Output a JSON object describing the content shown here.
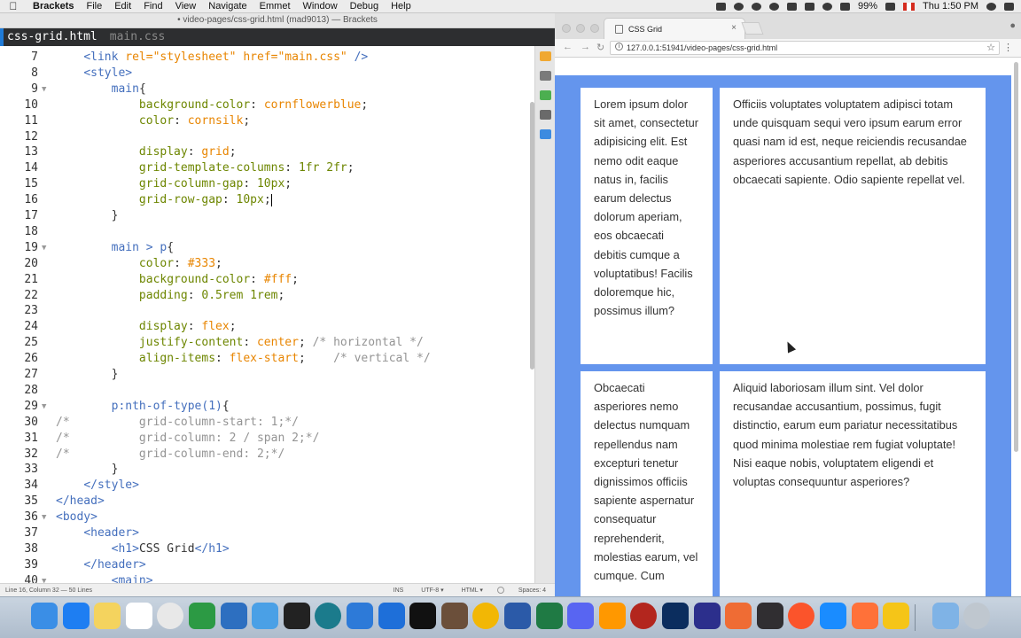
{
  "menubar": {
    "app": "Brackets",
    "items": [
      "File",
      "Edit",
      "Find",
      "View",
      "Navigate",
      "Emmet",
      "Window",
      "Debug",
      "Help"
    ],
    "battery": "99%",
    "clock": "Thu 1:50 PM"
  },
  "editor": {
    "window_title": "• video-pages/css-grid.html (mad9013) — Brackets",
    "tabs": [
      "css-grid.html",
      "main.css"
    ],
    "lines": [
      {
        "n": "7",
        "fold": "",
        "code": [
          [
            "    ",
            "pun"
          ],
          [
            "<link ",
            "tag"
          ],
          [
            "rel=",
            "attr"
          ],
          [
            "\"stylesheet\"",
            "str"
          ],
          [
            " href=",
            "attr"
          ],
          [
            "\"main.css\"",
            "str"
          ],
          [
            " />",
            "tag"
          ]
        ]
      },
      {
        "n": "8",
        "fold": "",
        "code": [
          [
            "    ",
            "pun"
          ],
          [
            "<style>",
            "tag"
          ]
        ]
      },
      {
        "n": "9",
        "fold": "▼",
        "code": [
          [
            "        ",
            "pun"
          ],
          [
            "main",
            "sel"
          ],
          [
            "{",
            "pun"
          ]
        ]
      },
      {
        "n": "10",
        "fold": "",
        "code": [
          [
            "            ",
            "pun"
          ],
          [
            "background-color",
            "prop"
          ],
          [
            ": ",
            "pun"
          ],
          [
            "cornflowerblue",
            "val"
          ],
          [
            ";",
            "pun"
          ]
        ]
      },
      {
        "n": "11",
        "fold": "",
        "code": [
          [
            "            ",
            "pun"
          ],
          [
            "color",
            "prop"
          ],
          [
            ": ",
            "pun"
          ],
          [
            "cornsilk",
            "val"
          ],
          [
            ";",
            "pun"
          ]
        ]
      },
      {
        "n": "12",
        "fold": "",
        "code": []
      },
      {
        "n": "13",
        "fold": "",
        "code": [
          [
            "            ",
            "pun"
          ],
          [
            "display",
            "prop"
          ],
          [
            ": ",
            "pun"
          ],
          [
            "grid",
            "val"
          ],
          [
            ";",
            "pun"
          ]
        ]
      },
      {
        "n": "14",
        "fold": "",
        "code": [
          [
            "            ",
            "pun"
          ],
          [
            "grid-template-columns",
            "prop"
          ],
          [
            ": ",
            "pun"
          ],
          [
            "1fr 2fr",
            "num"
          ],
          [
            ";",
            "pun"
          ]
        ]
      },
      {
        "n": "15",
        "fold": "",
        "code": [
          [
            "            ",
            "pun"
          ],
          [
            "grid-column-gap",
            "prop"
          ],
          [
            ": ",
            "pun"
          ],
          [
            "10px",
            "num"
          ],
          [
            ";",
            "pun"
          ]
        ]
      },
      {
        "n": "16",
        "fold": "",
        "code": [
          [
            "            ",
            "pun"
          ],
          [
            "grid-row-gap",
            "prop"
          ],
          [
            ": ",
            "pun"
          ],
          [
            "10px",
            "num"
          ],
          [
            ";",
            "pun"
          ]
        ],
        "cursor": true
      },
      {
        "n": "17",
        "fold": "",
        "code": [
          [
            "        ",
            "pun"
          ],
          [
            "}",
            "pun"
          ]
        ]
      },
      {
        "n": "18",
        "fold": "",
        "code": []
      },
      {
        "n": "19",
        "fold": "▼",
        "code": [
          [
            "        ",
            "pun"
          ],
          [
            "main > p",
            "sel"
          ],
          [
            "{",
            "pun"
          ]
        ]
      },
      {
        "n": "20",
        "fold": "",
        "code": [
          [
            "            ",
            "pun"
          ],
          [
            "color",
            "prop"
          ],
          [
            ": ",
            "pun"
          ],
          [
            "#333",
            "val"
          ],
          [
            ";",
            "pun"
          ]
        ]
      },
      {
        "n": "21",
        "fold": "",
        "code": [
          [
            "            ",
            "pun"
          ],
          [
            "background-color",
            "prop"
          ],
          [
            ": ",
            "pun"
          ],
          [
            "#fff",
            "val"
          ],
          [
            ";",
            "pun"
          ]
        ]
      },
      {
        "n": "22",
        "fold": "",
        "code": [
          [
            "            ",
            "pun"
          ],
          [
            "padding",
            "prop"
          ],
          [
            ": ",
            "pun"
          ],
          [
            "0.5rem 1rem",
            "num"
          ],
          [
            ";",
            "pun"
          ]
        ]
      },
      {
        "n": "23",
        "fold": "",
        "code": []
      },
      {
        "n": "24",
        "fold": "",
        "code": [
          [
            "            ",
            "pun"
          ],
          [
            "display",
            "prop"
          ],
          [
            ": ",
            "pun"
          ],
          [
            "flex",
            "val"
          ],
          [
            ";",
            "pun"
          ]
        ]
      },
      {
        "n": "25",
        "fold": "",
        "code": [
          [
            "            ",
            "pun"
          ],
          [
            "justify-content",
            "prop"
          ],
          [
            ": ",
            "pun"
          ],
          [
            "center",
            "val"
          ],
          [
            "; ",
            "pun"
          ],
          [
            "/* horizontal */",
            "cmt"
          ]
        ]
      },
      {
        "n": "26",
        "fold": "",
        "code": [
          [
            "            ",
            "pun"
          ],
          [
            "align-items",
            "prop"
          ],
          [
            ": ",
            "pun"
          ],
          [
            "flex-start",
            "val"
          ],
          [
            ";    ",
            "pun"
          ],
          [
            "/* vertical */",
            "cmt"
          ]
        ]
      },
      {
        "n": "27",
        "fold": "",
        "code": [
          [
            "        ",
            "pun"
          ],
          [
            "}",
            "pun"
          ]
        ]
      },
      {
        "n": "28",
        "fold": "",
        "code": []
      },
      {
        "n": "29",
        "fold": "▼",
        "code": [
          [
            "        ",
            "pun"
          ],
          [
            "p:nth-of-type(1)",
            "sel"
          ],
          [
            "{",
            "pun"
          ]
        ]
      },
      {
        "n": "30",
        "fold": "",
        "code": [
          [
            "/*          grid-column-start: 1;*/",
            "cmt"
          ]
        ]
      },
      {
        "n": "31",
        "fold": "",
        "code": [
          [
            "/*          grid-column: 2 / span 2;*/",
            "cmt"
          ]
        ]
      },
      {
        "n": "32",
        "fold": "",
        "code": [
          [
            "/*          grid-column-end: 2;*/",
            "cmt"
          ]
        ]
      },
      {
        "n": "33",
        "fold": "",
        "code": [
          [
            "        ",
            "pun"
          ],
          [
            "}",
            "pun"
          ]
        ]
      },
      {
        "n": "34",
        "fold": "",
        "code": [
          [
            "    ",
            "pun"
          ],
          [
            "</style>",
            "tag"
          ]
        ]
      },
      {
        "n": "35",
        "fold": "",
        "code": [
          [
            "</head>",
            "tag"
          ]
        ]
      },
      {
        "n": "36",
        "fold": "▼",
        "code": [
          [
            "<body>",
            "tag"
          ]
        ]
      },
      {
        "n": "37",
        "fold": "",
        "code": [
          [
            "    ",
            "pun"
          ],
          [
            "<header>",
            "tag"
          ]
        ]
      },
      {
        "n": "38",
        "fold": "",
        "code": [
          [
            "        ",
            "pun"
          ],
          [
            "<h1>",
            "tag"
          ],
          [
            "CSS Grid",
            "pun"
          ],
          [
            "</h1>",
            "tag"
          ]
        ]
      },
      {
        "n": "39",
        "fold": "",
        "code": [
          [
            "    ",
            "pun"
          ],
          [
            "</header>",
            "tag"
          ]
        ]
      },
      {
        "n": "40",
        "fold": "▼",
        "code": [
          [
            "        ",
            "pun"
          ],
          [
            "<main>",
            "tag"
          ]
        ]
      }
    ],
    "status": {
      "position": "Line 16, Column 32 — 50 Lines",
      "mode": "INS",
      "encoding": "UTF-8 ▾",
      "language": "HTML ▾",
      "spaces": "Spaces: 4"
    }
  },
  "browser": {
    "tab_title": "CSS Grid",
    "url": "127.0.0.1:51941/video-pages/css-grid.html",
    "cells": [
      "Lorem ipsum dolor sit amet, consectetur adipisicing elit. Est nemo odit eaque natus in, facilis earum delectus dolorum aperiam, eos obcaecati debitis cumque a voluptatibus! Facilis doloremque hic, possimus illum?",
      "Officiis voluptates voluptatem adipisci totam unde quisquam sequi vero ipsum earum error quasi nam id est, neque reiciendis recusandae asperiores accusantium repellat, ab debitis obcaecati sapiente. Odio sapiente repellat vel.",
      "Obcaecati asperiores nemo delectus numquam repellendus nam excepturi tenetur dignissimos officiis sapiente aspernatur consequatur reprehenderit, molestias earum, vel cumque. Cum",
      "Aliquid laboriosam illum sint. Vel dolor recusandae accusantium, possimus, fugit distinctio, earum eum pariatur necessitatibus quod minima molestiae rem fugiat voluptate! Nisi eaque nobis, voluptatem eligendi et voluptas consequuntur asperiores?"
    ]
  },
  "colors": {
    "page_background": "#6495ed",
    "editor_tab_bar": "#2d2e30",
    "active_tab_marker": "#1f7bd8"
  },
  "dock": {
    "icons": [
      "finder-icon",
      "app-store-icon",
      "notes-icon",
      "calendar-icon",
      "chrome-icon",
      "mongodb-icon",
      "sourcetree-icon",
      "folder-icon",
      "github-icon",
      "gitkraken-icon",
      "vscode-icon",
      "brackets-icon",
      "terminal-icon",
      "archive-icon",
      "sketch-icon",
      "word-icon",
      "excel-icon",
      "discord-icon",
      "sublime-icon",
      "filezilla-icon",
      "photoshop-icon",
      "eclipse-icon",
      "postman-icon",
      "obs-icon",
      "brave-icon",
      "safari-icon",
      "firefox-icon",
      "chrome-canary-icon",
      "downloads-icon",
      "trash-icon"
    ]
  }
}
